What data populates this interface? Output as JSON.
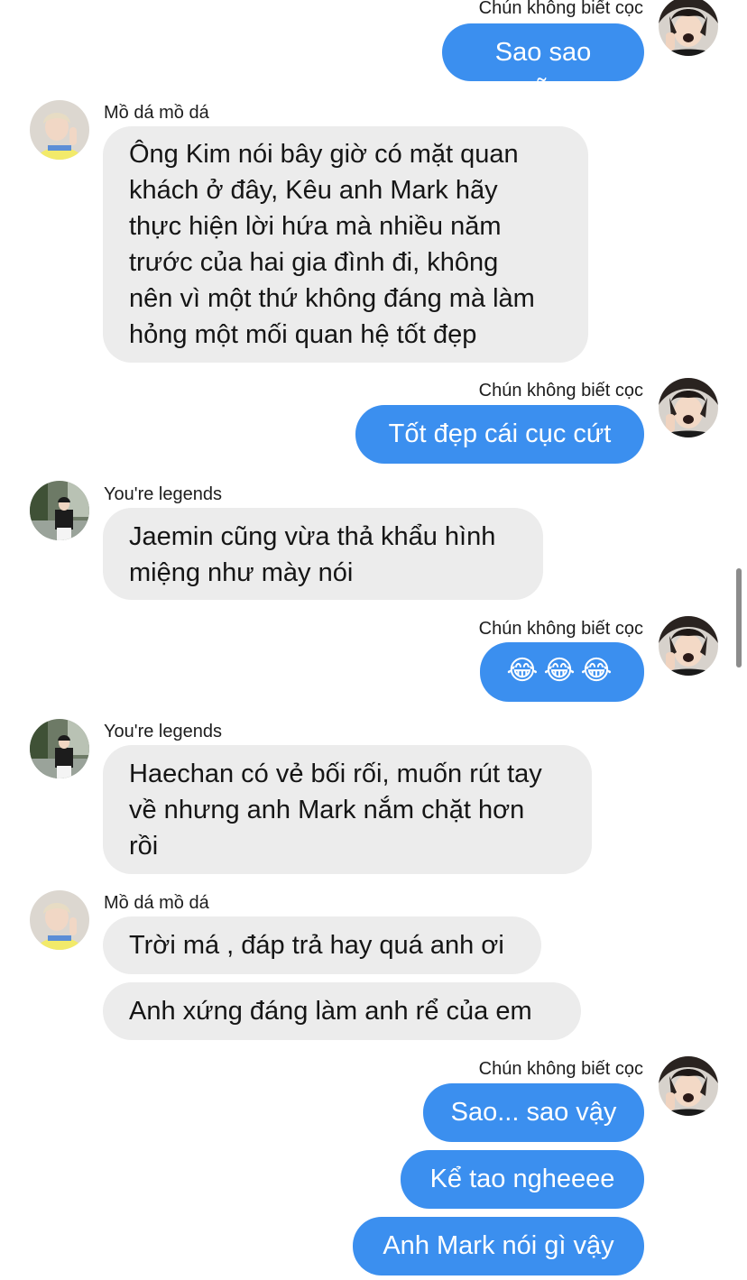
{
  "senders": {
    "me": "Chún không biết cọc",
    "mo": "Mồ dá mồ dá",
    "legends": "You're legends"
  },
  "avatars": {
    "me": "avatar-me-photo",
    "mo": "avatar-mo-photo",
    "legends": "avatar-legends-photo"
  },
  "messages": [
    {
      "from": "me",
      "text": "Sao sao nữa"
    },
    {
      "from": "mo",
      "text": "Ông Kim nói bây giờ có mặt quan\nkhách ở đây, Kêu anh Mark hãy\nthực hiện lời hứa mà nhiều năm\ntrước của hai gia đình đi, không\nnên vì một thứ không đáng mà làm\nhỏng một mối quan hệ tốt đẹp"
    },
    {
      "from": "me",
      "text": "Tốt đẹp cái cục cứt"
    },
    {
      "from": "legends",
      "text": "Jaemin cũng vừa thả khẩu hình\nmiệng như mày nói"
    },
    {
      "from": "me",
      "text": "😂😂😂"
    },
    {
      "from": "legends",
      "text": "Haechan có vẻ bối rối, muốn rút tay\nvề nhưng anh Mark nắm chặt hơn\nrồi"
    },
    {
      "from": "mo",
      "text": "Trời má , đáp trả hay quá anh ơi"
    },
    {
      "from": "mo",
      "text": "Anh xứng đáng làm anh rể của em"
    },
    {
      "from": "me",
      "text": "Sao... sao vậy"
    },
    {
      "from": "me",
      "text": "Kể tao ngheeee"
    },
    {
      "from": "me",
      "text": "Anh Mark nói gì vậy"
    }
  ],
  "colors": {
    "outgoing_bubble": "#3b8fef",
    "incoming_bubble": "#ececec"
  }
}
